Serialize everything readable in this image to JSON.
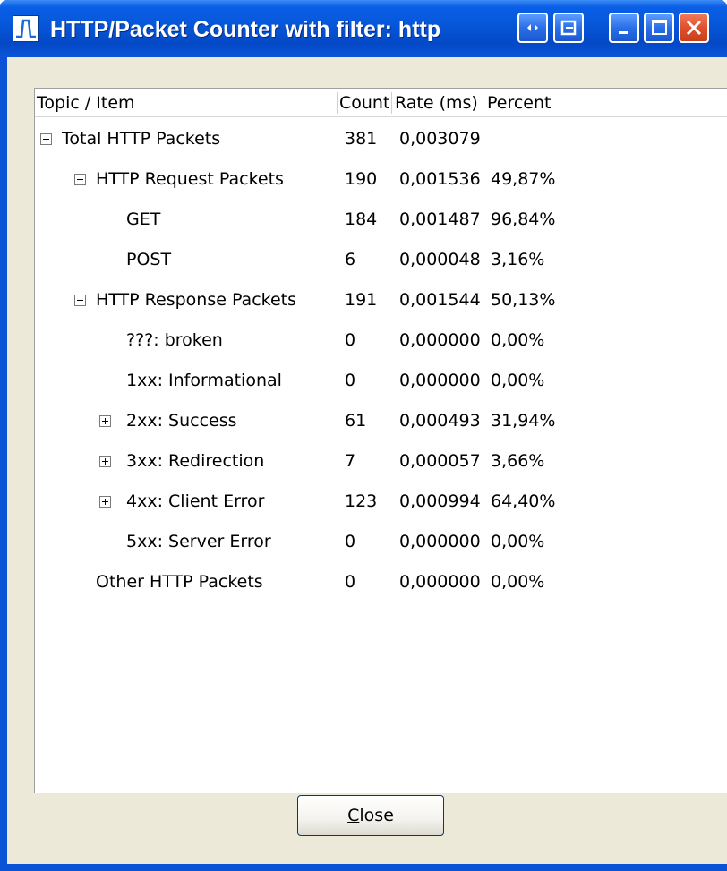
{
  "window": {
    "title": "HTTP/Packet Counter with filter: http"
  },
  "columns": [
    "Topic / Item",
    "Count",
    "Rate (ms)",
    "Percent"
  ],
  "rows": [
    {
      "label": "Total HTTP Packets",
      "count": "381",
      "rate": "0,003079",
      "percent": "",
      "expander": "minus"
    },
    {
      "label": "HTTP Request Packets",
      "count": "190",
      "rate": "0,001536",
      "percent": "49,87%",
      "expander": "minus"
    },
    {
      "label": "GET",
      "count": "184",
      "rate": "0,001487",
      "percent": "96,84%",
      "expander": ""
    },
    {
      "label": "POST",
      "count": "6",
      "rate": "0,000048",
      "percent": "3,16%",
      "expander": ""
    },
    {
      "label": "HTTP Response Packets",
      "count": "191",
      "rate": "0,001544",
      "percent": "50,13%",
      "expander": "minus"
    },
    {
      "label": "???: broken",
      "count": "0",
      "rate": "0,000000",
      "percent": "0,00%",
      "expander": ""
    },
    {
      "label": "1xx: Informational",
      "count": "0",
      "rate": "0,000000",
      "percent": "0,00%",
      "expander": ""
    },
    {
      "label": "2xx: Success",
      "count": "61",
      "rate": "0,000493",
      "percent": "31,94%",
      "expander": "plus"
    },
    {
      "label": "3xx: Redirection",
      "count": "7",
      "rate": "0,000057",
      "percent": "3,66%",
      "expander": "plus"
    },
    {
      "label": "4xx: Client Error",
      "count": "123",
      "rate": "0,000994",
      "percent": "64,40%",
      "expander": "plus"
    },
    {
      "label": "5xx: Server Error",
      "count": "0",
      "rate": "0,000000",
      "percent": "0,00%",
      "expander": ""
    },
    {
      "label": "Other HTTP Packets",
      "count": "0",
      "rate": "0,000000",
      "percent": "0,00%",
      "expander": ""
    }
  ],
  "buttons": {
    "close_mnemonic": "C",
    "close_rest": "lose"
  },
  "icons": {
    "app": "waveform-app-icon",
    "titlebar": [
      "maximize-toggle-icon",
      "restore-icon",
      "minimize-icon",
      "maximize-icon",
      "close-icon"
    ]
  },
  "colors": {
    "titlebar": "#0a5fe6",
    "client_bg": "#ece9d8",
    "close_button_title": "#e0502a"
  }
}
